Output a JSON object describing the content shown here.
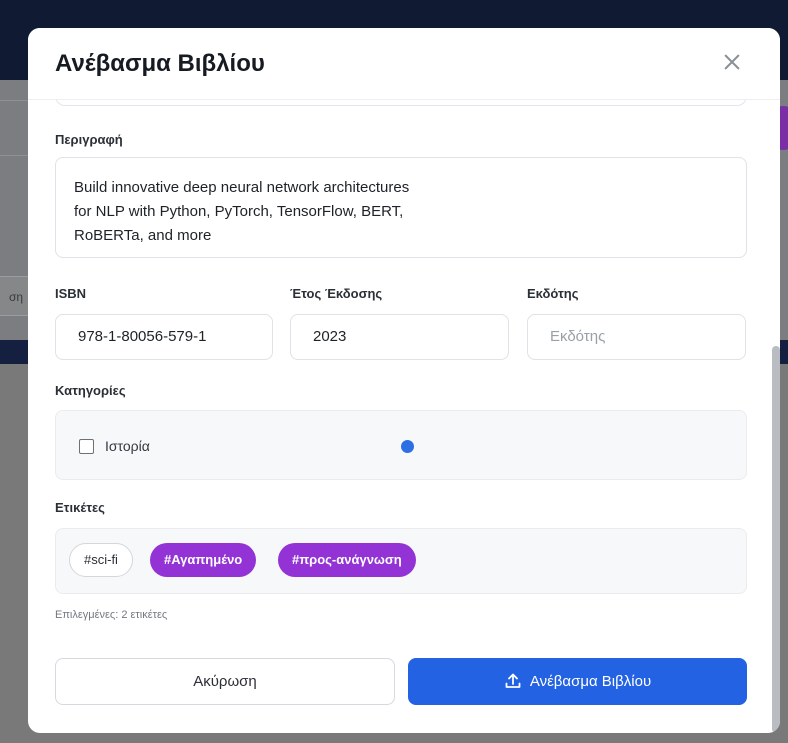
{
  "modal": {
    "title": "Ανέβασμα Βιβλίου"
  },
  "description": {
    "label": "Περιγραφή",
    "value": "Build innovative deep neural network architectures\nfor NLP with Python, PyTorch, TensorFlow, BERT,\nRoBERTa, and more"
  },
  "isbn": {
    "label": "ISBN",
    "value": "978-1-80056-579-1"
  },
  "year": {
    "label": "Έτος Έκδοσης",
    "value": "2023"
  },
  "publisher": {
    "label": "Εκδότης",
    "value": "",
    "placeholder": "Εκδότης"
  },
  "categories": {
    "label": "Κατηγορίες",
    "items": [
      {
        "label": "Ιστορία",
        "checked": false
      }
    ]
  },
  "tags": {
    "label": "Ετικέτες",
    "items": [
      {
        "label": "#sci-fi",
        "selected": false
      },
      {
        "label": "#Αγαπημένο",
        "selected": true
      },
      {
        "label": "#προς-ανάγνωση",
        "selected": true
      }
    ],
    "selected_count_text": "Επιλεγμένες: 2 ετικέτες"
  },
  "buttons": {
    "cancel": "Ακύρωση",
    "upload": "Ανέβασμα Βιβλίου"
  },
  "background": {
    "partial_input_text": "ση"
  },
  "colors": {
    "accent": "#2262e3",
    "tag_selected": "#9333d6"
  }
}
